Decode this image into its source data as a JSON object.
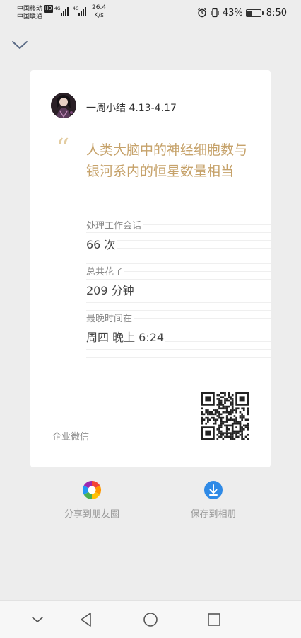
{
  "status_bar": {
    "carrier_1": "中国移动",
    "carrier_1_badge": "HD",
    "carrier_2": "中国联通",
    "network_1": "4G",
    "network_2": "4G",
    "speed_value": "26.4",
    "speed_unit": "K/s",
    "battery_percent": "43%",
    "battery_level": 0.43,
    "time": "8:50",
    "icons": [
      "alarm-icon",
      "vibrate-icon",
      "battery-icon"
    ]
  },
  "card": {
    "title": "一周小结 4.13-4.17",
    "quote_mark": "“",
    "headline": "人类大脑中的神经细胞数与银河系内的恒星数量相当",
    "stats": [
      {
        "label": "处理工作会话",
        "value": "66 次"
      },
      {
        "label": "总共花了",
        "value": "209 分钟"
      },
      {
        "label": "最晚时间在",
        "value": "周四 晚上 6:24"
      }
    ],
    "brand": "企业微信"
  },
  "actions": {
    "share_label": "分享到朋友圈",
    "save_label": "保存到相册"
  },
  "colors": {
    "accent_gold": "#c6a26a",
    "save_blue": "#2f8ae6",
    "background": "#ededed"
  }
}
